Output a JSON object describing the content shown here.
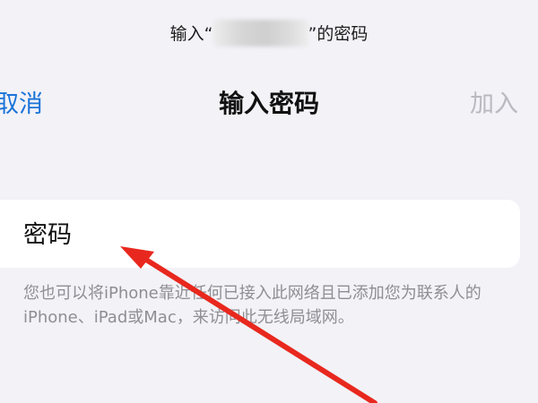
{
  "prompt": {
    "prefix": "输入“",
    "suffix": "”的密码"
  },
  "nav": {
    "cancel_label": "取消",
    "title": "输入密码",
    "join_label": "加入"
  },
  "password_field": {
    "placeholder": "密码",
    "value": ""
  },
  "footnote": "您也可以将iPhone靠近任何已接入此网络且已添加您为联系人的iPhone、iPad或Mac，来访问此无线局域网。",
  "colors": {
    "accent": "#1a73d9",
    "disabled": "#b9b9bf",
    "background": "#f2f2f7",
    "annotation_arrow": "#e8281e"
  }
}
